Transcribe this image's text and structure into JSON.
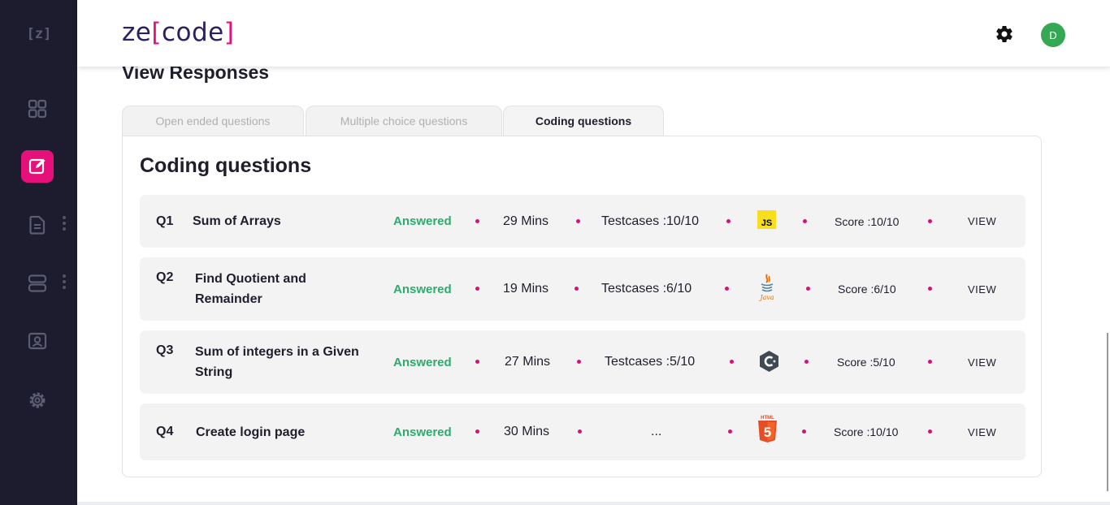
{
  "sidebar": {
    "logo": "[z]",
    "items": [
      {
        "icon": "grid-icon"
      },
      {
        "icon": "edit-icon",
        "active": true
      },
      {
        "icon": "document-icon"
      },
      {
        "icon": "server-icon"
      },
      {
        "icon": "monitor-user-icon"
      },
      {
        "icon": "gear-icon"
      }
    ]
  },
  "header": {
    "logo_prefix": "ze",
    "logo_open": "[",
    "logo_word": "code",
    "logo_close": "]",
    "avatar_initial": "D"
  },
  "page": {
    "title": "View Responses"
  },
  "tabs": [
    {
      "label": "Open ended questions"
    },
    {
      "label": "Multiple choice questions"
    },
    {
      "label": "Coding questions",
      "active": true
    }
  ],
  "panel": {
    "title": "Coding questions"
  },
  "questions": [
    {
      "num": "Q1",
      "title_line1": "Sum of Arrays",
      "title_line2": "",
      "status": "Answered",
      "time": "29 Mins",
      "testcases": "Testcases :10/10",
      "language": "JS",
      "score": "Score :10/10",
      "action": "VIEW"
    },
    {
      "num": "Q2",
      "title_line1": "Find Quotient and",
      "title_line2": "Remainder",
      "status": "Answered",
      "time": "19 Mins",
      "testcases": "Testcases :6/10",
      "language": "Java",
      "score": "Score :6/10",
      "action": "VIEW"
    },
    {
      "num": "Q3",
      "title_line1": "Sum of integers in a Given",
      "title_line2": "String",
      "status": "Answered",
      "time": "27 Mins",
      "testcases": "Testcases :5/10",
      "language": "C",
      "score": "Score :5/10",
      "action": "VIEW"
    },
    {
      "num": "Q4",
      "title_line1": "Create login page",
      "title_line2": "",
      "status": "Answered",
      "time": "30 Mins",
      "testcases": "...",
      "language": "HTML",
      "score": "Score :10/10",
      "action": "VIEW"
    }
  ],
  "colors": {
    "sidebar_bg": "#1c1c2e",
    "accent": "#e6107b",
    "answered": "#2eaa6d",
    "brand_text": "#2c2060",
    "avatar": "#34a853",
    "js_yellow": "#f7df1e",
    "html_orange": "#e44d26"
  }
}
